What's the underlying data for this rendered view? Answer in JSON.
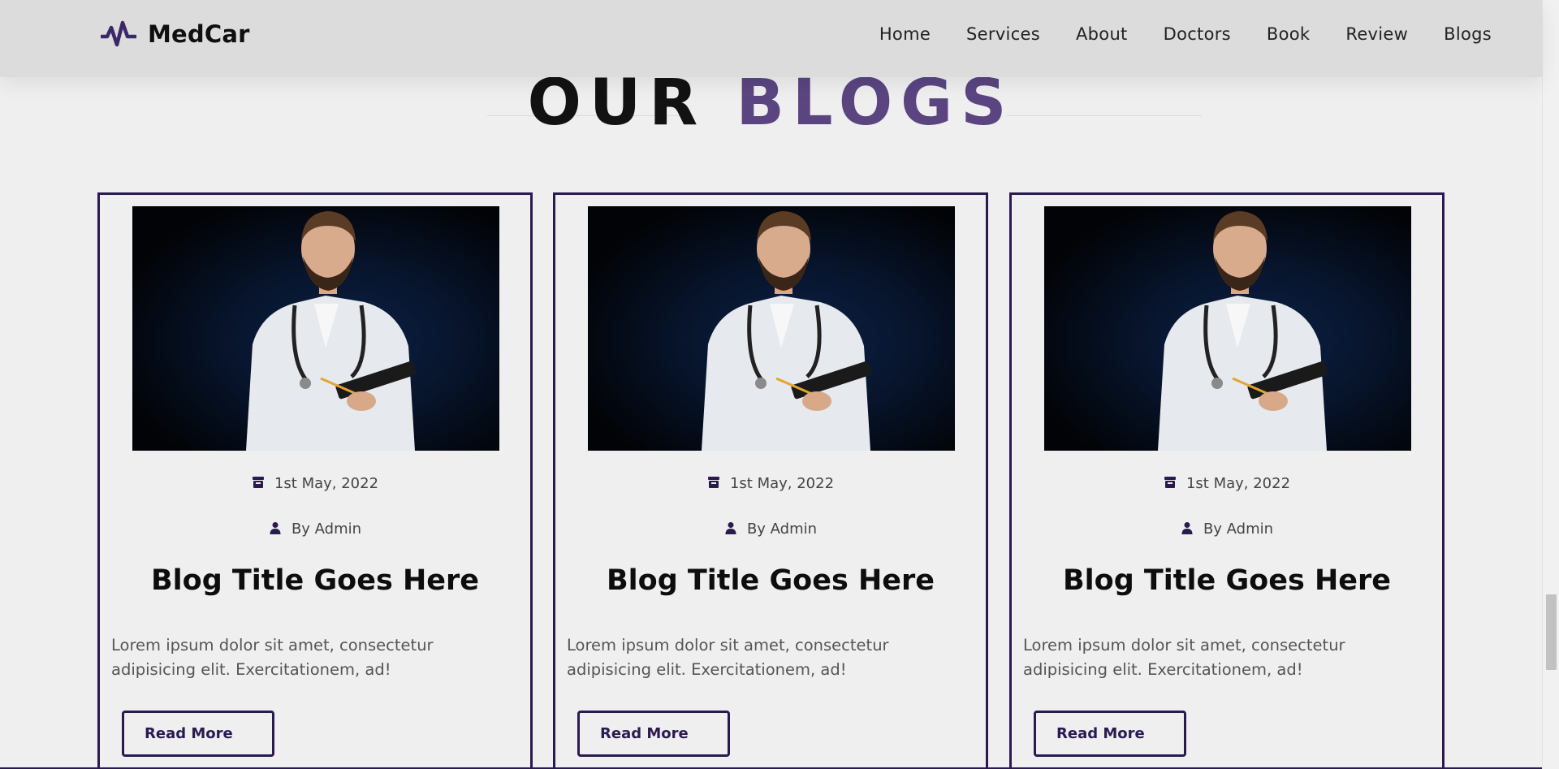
{
  "brand": {
    "name": "MedCar",
    "icon": "heartbeat-icon",
    "accent_color": "#2a1a4f",
    "heading_accent_color": "#5a4580"
  },
  "nav": {
    "items": [
      "Home",
      "Services",
      "About",
      "Doctors",
      "Book",
      "Review",
      "Blogs"
    ]
  },
  "section": {
    "heading_word1": "OUR",
    "heading_word2": "BLOGS"
  },
  "blogs": [
    {
      "date": "1st May, 2022",
      "author": "By Admin",
      "title": "Blog Title Goes Here",
      "excerpt": "Lorem ipsum dolor sit amet, consectetur adipisicing elit. Exercitationem, ad!",
      "button": "Read More",
      "date_icon": "calendar-icon",
      "author_icon": "user-icon"
    },
    {
      "date": "1st May, 2022",
      "author": "By Admin",
      "title": "Blog Title Goes Here",
      "excerpt": "Lorem ipsum dolor sit amet, consectetur adipisicing elit. Exercitationem, ad!",
      "button": "Read More",
      "date_icon": "calendar-icon",
      "author_icon": "user-icon"
    },
    {
      "date": "1st May, 2022",
      "author": "By Admin",
      "title": "Blog Title Goes Here",
      "excerpt": "Lorem ipsum dolor sit amet, consectetur adipisicing elit. Exercitationem, ad!",
      "button": "Read More",
      "date_icon": "calendar-icon",
      "author_icon": "user-icon"
    }
  ]
}
